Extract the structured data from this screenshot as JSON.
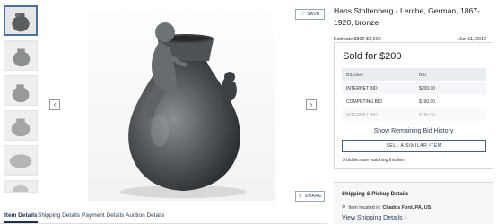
{
  "lot": {
    "title": "Hans Stoltenberg - Lerche, German, 1867-1920, bronze",
    "estimate": "Estimate $800-$1,600",
    "date": "Jun 11, 2019"
  },
  "actions": {
    "save_label": "SAVE",
    "share_label": "SHARE"
  },
  "gallery": {
    "prev_icon": "chevron-left-icon",
    "next_icon": "chevron-right-icon",
    "thumbnail_count": 6
  },
  "bidding": {
    "sold_text": "Sold for $200",
    "columns": [
      "BIDDER",
      "BID"
    ],
    "rows": [
      {
        "bidder": "INTERNET BID",
        "bid": "$200.00"
      },
      {
        "bidder": "COMPETING BID",
        "bid": "$190.00"
      },
      {
        "bidder": "INTERNET BID",
        "bid": "$180.00"
      }
    ],
    "history_link": "Show Remaining Bid History",
    "similar_button": "SELL A SIMILAR ITEM",
    "watching": "3 bidders are watching this item"
  },
  "shipping": {
    "title": "Shipping & Pickup Details",
    "location_prefix": "Item located in:",
    "location": "Chadds Ford, PA, US",
    "link": "View Shipping Details ›"
  },
  "tabs": [
    {
      "label": "Item Details",
      "active": true
    },
    {
      "label": "Shipping Details",
      "active": false
    },
    {
      "label": "Payment Details",
      "active": false
    },
    {
      "label": "Auction Details",
      "active": false
    }
  ],
  "colors": {
    "accent": "#1e3050",
    "vase": "#55595b",
    "border": "#d8d8d8"
  }
}
